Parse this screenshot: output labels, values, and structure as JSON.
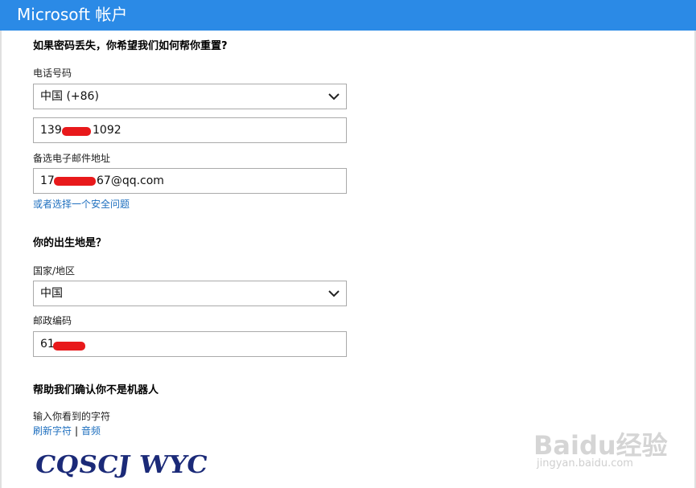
{
  "header": {
    "title": "Microsoft 帐户"
  },
  "recovery": {
    "heading": "如果密码丢失，你希望我们如何帮你重置?",
    "phone_label": "电话号码",
    "country_code_value": "中国 (+86)",
    "phone_prefix": "139",
    "phone_suffix": "1092",
    "email_label": "备选电子邮件地址",
    "email_prefix": "17",
    "email_suffix": "67@qq.com",
    "security_question_link": "或者选择一个安全问题"
  },
  "birthplace": {
    "heading": "你的出生地是？",
    "country_label": "国家/地区",
    "country_value": "中国",
    "postal_label": "邮政编码",
    "postal_prefix": "61"
  },
  "captcha": {
    "heading": "帮助我们确认你不是机器人",
    "prompt": "输入你看到的字符",
    "refresh_link": "刷新字符",
    "separator": "|",
    "audio_link": "音频",
    "image_text": "CQSCJ WYC"
  },
  "watermark": {
    "brand": "Baidu经验",
    "url": "jingyan.baidu.com"
  },
  "colors": {
    "header_bg": "#2b8ae6",
    "link": "#1e6fbf",
    "redaction": "#e8191b"
  }
}
